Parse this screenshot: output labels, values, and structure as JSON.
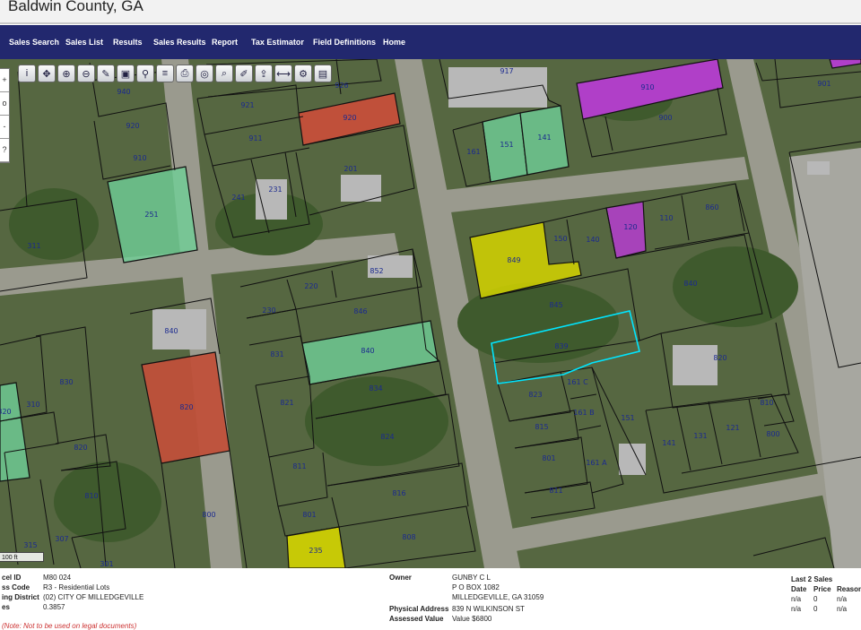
{
  "header": {
    "title": "Baldwin County, GA"
  },
  "nav": {
    "items": [
      "Sales Search",
      "Sales List",
      "Results",
      "Sales Results",
      "Report",
      "Tax Estimator",
      "Field Definitions",
      "Home"
    ]
  },
  "toolbar": {
    "icons": [
      "info-icon",
      "pan-icon",
      "zoom-in-icon",
      "zoom-out-icon",
      "eraser-icon",
      "select-icon",
      "pin-icon",
      "layers-icon",
      "print-icon",
      "buffer-icon",
      "search-icon",
      "draw-icon",
      "export-icon",
      "measure-icon",
      "settings-icon",
      "save-icon"
    ]
  },
  "zoom": {
    "labels": [
      "+",
      "o",
      "-",
      "?"
    ]
  },
  "scale": {
    "label": "100 ft"
  },
  "parcels": [
    "917",
    "910",
    "901",
    "940",
    "926",
    "921",
    "920",
    "920",
    "911",
    "910",
    "161",
    "151",
    "141",
    "900",
    "201",
    "231",
    "241",
    "251",
    "311",
    "849",
    "150",
    "140",
    "120",
    "110",
    "860",
    "852",
    "220",
    "230",
    "846",
    "840",
    "840",
    "845",
    "840",
    "831",
    "839",
    "820",
    "830",
    "310",
    "320",
    "821",
    "834",
    "823",
    "161 C",
    "820",
    "151",
    "815",
    "161 B",
    "141",
    "131",
    "121",
    "810",
    "800",
    "824",
    "820",
    "811",
    "161 A",
    "801",
    "811",
    "816",
    "810",
    "801",
    "800",
    "235",
    "808",
    "315",
    "307",
    "301"
  ],
  "details": {
    "left_labels": [
      "cel ID",
      "ss Code",
      "ing District",
      "es"
    ],
    "left_values": [
      "M80 024",
      "R3 - Residential Lots",
      "(02) CITY OF MILLEDGEVILLE",
      "0.3857"
    ],
    "owner_label": "Owner",
    "owner_lines": [
      "GUNBY C L",
      "P O BOX 1082",
      "MILLEDGEVILLE, GA 31059"
    ],
    "phys_label": "Physical Address",
    "phys_value": "839 N WILKINSON ST",
    "assessed_label": "Assessed Value",
    "assessed_value": "Value $6800",
    "sales_title": "Last 2 Sales",
    "sales_headers": [
      "Date",
      "Price",
      "Reason"
    ],
    "sales_rows": [
      [
        "n/a",
        "0",
        "n/a"
      ],
      [
        "n/a",
        "0",
        "n/a"
      ]
    ],
    "note": "(Note: Not to be used on legal documents)"
  },
  "colors": {
    "nav": "#22286e",
    "green": "#6fcf97",
    "red": "#c0503a",
    "yellow": "#d4d400",
    "magenta": "#b03fc8",
    "selected": "#00e5ff"
  }
}
